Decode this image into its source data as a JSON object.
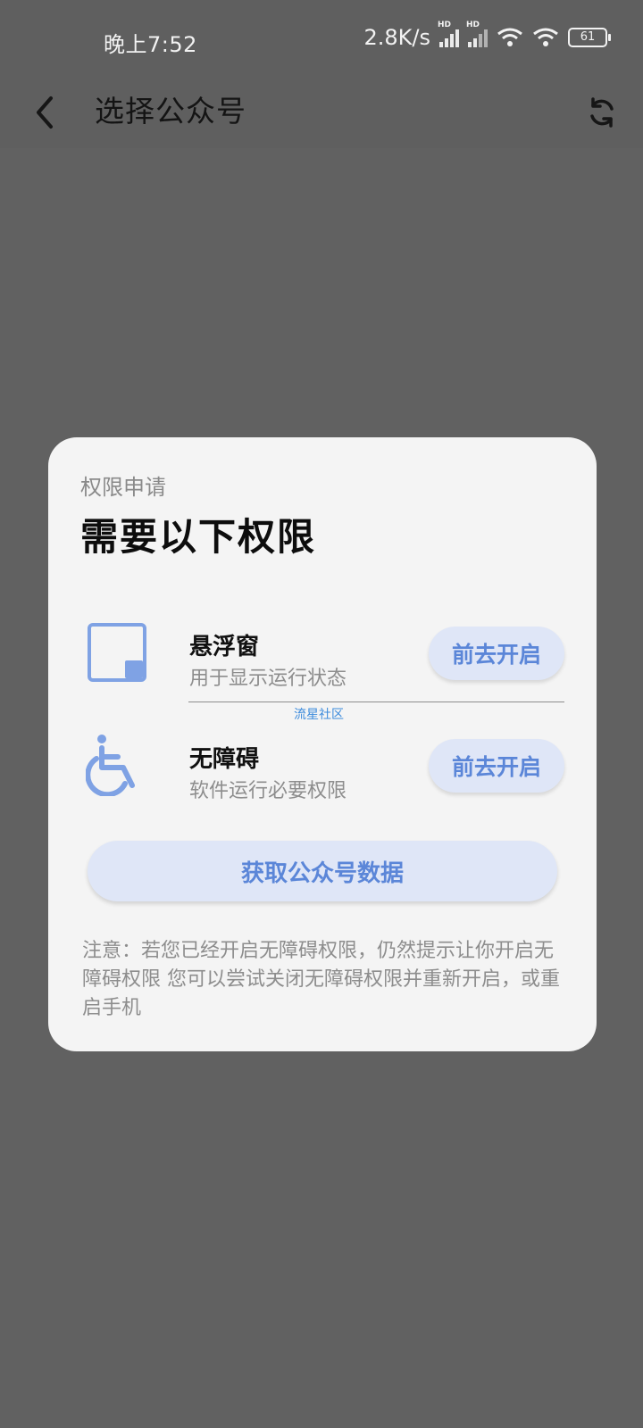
{
  "status_bar": {
    "time": "晚上7:52",
    "network_speed": "2.8K/s",
    "signal_badge": "HD",
    "battery": "61",
    "icons": [
      "signal-icon",
      "signal-icon",
      "wifi-icon",
      "wifi-icon",
      "battery-icon"
    ]
  },
  "app_bar": {
    "title": "选择公众号",
    "back_icon": "chevron-left-icon",
    "refresh_icon": "refresh-icon"
  },
  "dialog": {
    "subtitle": "权限申请",
    "title": "需要以下权限",
    "permissions": [
      {
        "icon": "floating-window-icon",
        "title": "悬浮窗",
        "description": "用于显示运行状态",
        "button_label": "前去开启"
      },
      {
        "icon": "accessibility-icon",
        "title": "无障碍",
        "description": "软件运行必要权限",
        "button_label": "前去开启"
      }
    ],
    "watermark": "流星社区",
    "primary_button_label": "获取公众号数据",
    "note": "注意：若您已经开启无障碍权限，仍然提示让你开启无障碍权限 您可以尝试关闭无障碍权限并重新开启，或重启手机"
  },
  "colors": {
    "accent": "#5b86d8",
    "button_bg": "#dfe6f7",
    "overlay_bg": "#616161",
    "dialog_bg": "#f4f4f4"
  }
}
